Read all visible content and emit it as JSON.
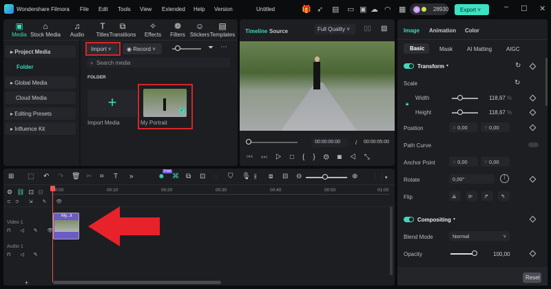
{
  "app": {
    "name": "Wondershare Filmora",
    "project": "Untitled",
    "credits": "28930",
    "export": "Export"
  },
  "menu": [
    "File",
    "Edit",
    "Tools",
    "View",
    "Extended",
    "Help",
    "Version"
  ],
  "tabs": [
    {
      "label": "Media",
      "icon": "media-icon"
    },
    {
      "label": "Stock Media",
      "icon": "stock-icon"
    },
    {
      "label": "Audio",
      "icon": "music-icon"
    },
    {
      "label": "Titles",
      "icon": "text-icon"
    },
    {
      "label": "Transitions",
      "icon": "transition-icon"
    },
    {
      "label": "Effects",
      "icon": "effects-icon"
    },
    {
      "label": "Filters",
      "icon": "filter-icon"
    },
    {
      "label": "Stickers",
      "icon": "sticker-icon"
    },
    {
      "label": "Templates",
      "icon": "template-icon"
    }
  ],
  "sidebar": [
    "Project Media",
    "Folder",
    "Global Media",
    "Cloud Media",
    "Editing Presets",
    "Influence Kit"
  ],
  "media": {
    "import": "Import",
    "record": "Record",
    "search_placeholder": "Search media",
    "folder_heading": "FOLDER",
    "items": [
      "Import Media",
      "My Portrait"
    ]
  },
  "preview": {
    "tab_timeline": "Timeline",
    "tab_source": "Source",
    "quality": "Full Quality",
    "current": "00:00:00:00",
    "sep": "/",
    "total": "00:00:05:00"
  },
  "props": {
    "tabs": [
      "Image",
      "Animation",
      "Color"
    ],
    "subtabs": [
      "Basic",
      "Mask",
      "AI Matting",
      "AIGC"
    ],
    "transform": "Transform",
    "scale": "Scale",
    "width": "Width",
    "width_val": "118,67",
    "height": "Height",
    "height_val": "118,67",
    "pct": "%",
    "position": "Position",
    "pos_x": "0,00",
    "pos_y": "0,00",
    "x": "X",
    "y": "Y",
    "path_curve": "Path Curve",
    "anchor": "Anchor Point",
    "anc_x": "0,00",
    "anc_y": "0,00",
    "rotate": "Rotate",
    "rotate_val": "0,00°",
    "flip": "Flip",
    "compositing": "Compositing",
    "blend": "Blend Mode",
    "blend_val": "Normal",
    "opacity": "Opacity",
    "opacity_val": "100,00",
    "reset": "Reset"
  },
  "timeline": {
    "ticks": [
      "00:00",
      "00:10",
      "00:20",
      "00:30",
      "00:40",
      "00:50",
      "01:00"
    ],
    "track_video": "Video 1",
    "track_audio": "Audio 1",
    "clip": "My...it",
    "badge": "Free"
  }
}
